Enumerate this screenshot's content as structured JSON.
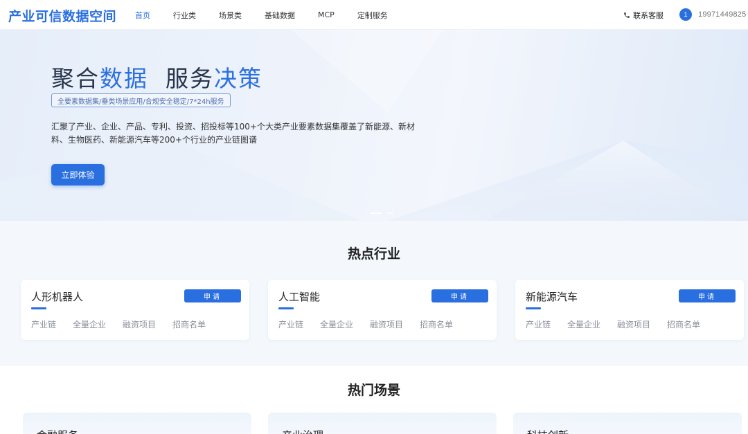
{
  "header": {
    "logo": "产业可信数据空间",
    "nav": [
      {
        "label": "首页",
        "active": true
      },
      {
        "label": "行业类",
        "active": false
      },
      {
        "label": "场景类",
        "active": false
      },
      {
        "label": "基础数据",
        "active": false
      },
      {
        "label": "MCP",
        "active": false
      },
      {
        "label": "定制服务",
        "active": false
      }
    ],
    "service_label": "联系客服",
    "service_icon": "phone-icon",
    "avatar_text": "1",
    "phone": "19971449825"
  },
  "hero": {
    "title_part1": "聚合",
    "title_part2": "数据",
    "title_part3": "服务",
    "title_part4": "决策",
    "tagline": "全要素数据集/垂类场景应用/合规安全稳定/7*24h服务",
    "description": "汇聚了产业、企业、产品、专利、投资、招投标等100+个大类产业要素数据集覆盖了新能源、新材料、生物医药、新能源汽车等200+个行业的产业链图谱",
    "button": "立即体验"
  },
  "hot_industries": {
    "title": "热点行业",
    "apply_label": "申请",
    "cards": [
      {
        "name": "人形机器人",
        "links": [
          "产业链",
          "全量企业",
          "融资项目",
          "招商名单"
        ]
      },
      {
        "name": "人工智能",
        "links": [
          "产业链",
          "全量企业",
          "融资项目",
          "招商名单"
        ]
      },
      {
        "name": "新能源汽车",
        "links": [
          "产业链",
          "全量企业",
          "融资项目",
          "招商名单"
        ]
      }
    ]
  },
  "hot_scenes": {
    "title": "热门场景",
    "cards": [
      {
        "name": "金融服务"
      },
      {
        "name": "产业治理"
      },
      {
        "name": "科技创新"
      }
    ]
  },
  "colors": {
    "accent": "#2a6fe0",
    "hero_bg": "#e6eefa",
    "section_bg": "#f4f8fd"
  }
}
